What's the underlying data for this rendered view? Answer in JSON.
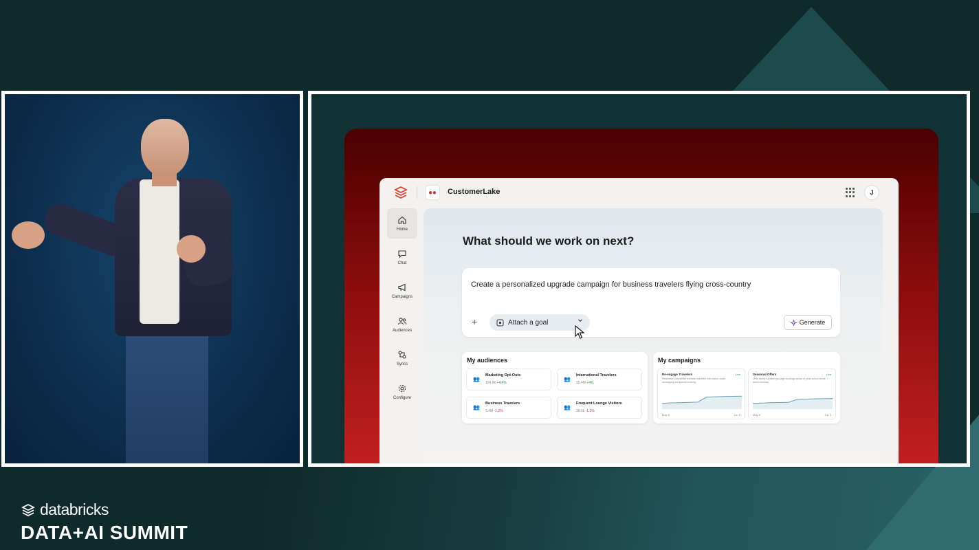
{
  "app": {
    "title": "CustomerLake",
    "avatar_initial": "J"
  },
  "sidebar": {
    "items": [
      {
        "label": "Home",
        "icon": "home-icon",
        "active": true
      },
      {
        "label": "Chat",
        "icon": "chat-icon",
        "active": false
      },
      {
        "label": "Campaigns",
        "icon": "megaphone-icon",
        "active": false
      },
      {
        "label": "Audiences",
        "icon": "users-icon",
        "active": false
      },
      {
        "label": "Syncs",
        "icon": "sync-icon",
        "active": false
      },
      {
        "label": "Configure",
        "icon": "gear-icon",
        "active": false
      }
    ]
  },
  "main": {
    "heading": "What should we work on next?",
    "prompt": {
      "value": "Create a personalized upgrade campaign for business travelers flying cross-country",
      "add_symbol": "+",
      "goal_chip_label": "Attach a goal",
      "generate_label": "Generate"
    },
    "audiences": {
      "title": "My audiences",
      "items": [
        {
          "name": "Marketing Opt-Outs",
          "size": "104.9k",
          "change": "+4.4%",
          "trend": "up"
        },
        {
          "name": "International Travelers",
          "size": "15.4M",
          "change": "+4%",
          "trend": "up"
        },
        {
          "name": "Business Travelers",
          "size": "5.4M",
          "change": "-1.2%",
          "trend": "down"
        },
        {
          "name": "Frequent Lounge Visitors",
          "size": "38.6k",
          "change": "-1.2%",
          "trend": "down"
        }
      ]
    },
    "campaigns": {
      "title": "My campaigns",
      "items": [
        {
          "name": "Re-engage Travelers",
          "status": "Live",
          "description": "Reactivate competitive business travelers with status match messaging and special booking.",
          "start": "May 8",
          "end": "Jun 5",
          "trend": [
            0.3,
            0.32,
            0.33,
            0.35,
            0.36,
            0.62,
            0.64,
            0.65,
            0.66,
            0.67
          ]
        },
        {
          "name": "Seasonal Offers",
          "status": "Live",
          "description": "Drive family vacation package bookings ahead of peak school break travel windows.",
          "start": "May 8",
          "end": "Jun 3",
          "trend": [
            0.3,
            0.31,
            0.33,
            0.34,
            0.35,
            0.5,
            0.52,
            0.53,
            0.54,
            0.55
          ]
        }
      ]
    }
  },
  "event": {
    "company": "databricks",
    "name": "DATA+AI SUMMIT"
  },
  "colors": {
    "accent_red": "#c22020",
    "positive": "#2f8a48",
    "negative": "#c03a3a"
  }
}
